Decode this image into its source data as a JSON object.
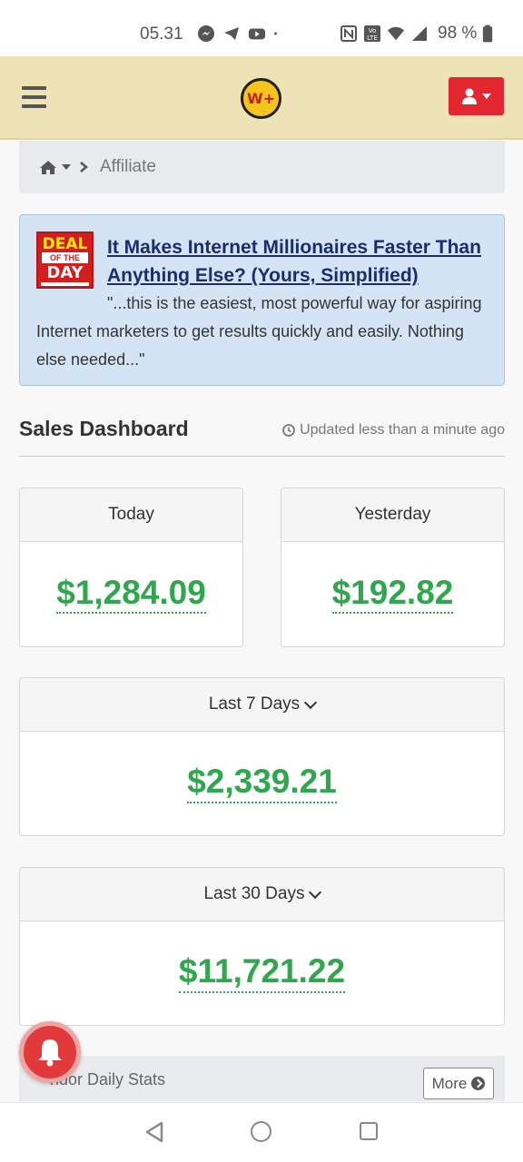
{
  "status_bar": {
    "time": "05.31",
    "battery": "98 %",
    "icons": [
      "messenger-icon",
      "telegram-icon",
      "youtube-icon",
      "dot-icon",
      "nfc-icon",
      "volte-icon",
      "wifi-icon",
      "signal-icon",
      "battery-icon"
    ]
  },
  "header": {
    "logo_text": "W+",
    "menu_icon": "hamburger-icon",
    "user_icon": "user-icon",
    "colors": {
      "header_bg": "#ede3b7",
      "user_button": "#e3262f"
    }
  },
  "breadcrumb": {
    "home_icon": "home-icon",
    "current": "Affiliate"
  },
  "deal": {
    "badge": {
      "line1": "DEAL",
      "line2": "OF THE",
      "line3": "DAY",
      "line4": "www.warriorplus.com"
    },
    "title": "It Makes Internet Millionaires Faster Than Anything Else? (Yours, Simplified)",
    "quote": "\"...this is the easiest, most powerful way for aspiring Internet marketers to get results quickly and easily. Nothing else needed...\""
  },
  "dashboard": {
    "title": "Sales Dashboard",
    "updated": "Updated less than a minute ago",
    "cards": {
      "today": {
        "label": "Today",
        "amount": "$1,284.09"
      },
      "yesterday": {
        "label": "Yesterday",
        "amount": "$192.82"
      },
      "last7": {
        "label": "Last 7 Days",
        "amount": "$2,339.21"
      },
      "last30": {
        "label": "Last 30 Days",
        "amount": "$11,721.22"
      }
    },
    "colors": {
      "amount": "#2ea84c"
    }
  },
  "vendor": {
    "label": "Vendor Daily Stats",
    "visible_label": "ndor Daily Stats",
    "more": "More"
  }
}
